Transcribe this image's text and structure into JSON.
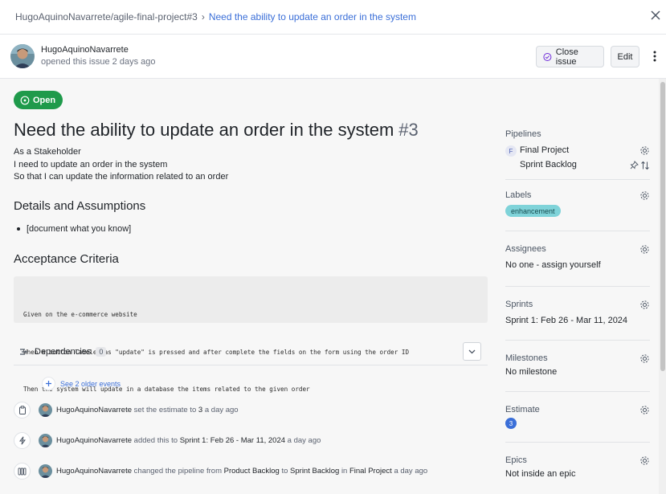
{
  "breadcrumb": {
    "repo": "HugoAquinoNavarrete/agile-final-project#3",
    "separator": "›",
    "current": "Need the ability to update an order in the system"
  },
  "header": {
    "author": "HugoAquinoNavarrete",
    "opened_text": "opened this issue 2 days ago",
    "close_button": "Close issue",
    "edit_button": "Edit"
  },
  "issue": {
    "status": "Open",
    "title": "Need the ability to update an order in the system",
    "number": "#3",
    "story": [
      "As a Stakeholder",
      "I need to update an order in the system",
      "So that I can update the information related to an order"
    ],
    "details_heading": "Details and Assumptions",
    "details_items": [
      "[document what you know]"
    ],
    "acceptance_heading": "Acceptance Criteria",
    "acceptance_code": [
      "Given on the e-commerce website",
      "When a button labeled as \"update\" is pressed and after complete the fields on the form using the order ID",
      "Then the system will update in a database the items related to the given order"
    ]
  },
  "dependencies": {
    "label": "Dependencies",
    "count": "0"
  },
  "timeline": {
    "older_link": "See 2 older events",
    "events": [
      {
        "icon": "clipboard-icon",
        "user": "HugoAquinoNavarrete",
        "text_a": "set the estimate to",
        "strong_a": "3",
        "time": "a day ago"
      },
      {
        "icon": "lightning-icon",
        "user": "HugoAquinoNavarrete",
        "text_a": "added this to",
        "strong_a": "Sprint 1: Feb 26 - Mar 11, 2024",
        "time": "a day ago"
      },
      {
        "icon": "pipeline-icon",
        "user": "HugoAquinoNavarrete",
        "text_a": "changed the pipeline from",
        "strong_a": "Product Backlog",
        "text_b": "to",
        "strong_b": "Sprint Backlog",
        "text_c": "in",
        "strong_c": "Final Project",
        "time": "a day ago"
      }
    ]
  },
  "sidebar": {
    "pipelines": {
      "label": "Pipelines",
      "workspace_badge": "F",
      "workspace": "Final Project",
      "pipeline": "Sprint Backlog"
    },
    "labels": {
      "label": "Labels",
      "chip": "enhancement",
      "chip_color": "#7fd3d9"
    },
    "assignees": {
      "label": "Assignees",
      "value": "No one -",
      "action": "assign yourself"
    },
    "sprints": {
      "label": "Sprints",
      "value": "Sprint 1: Feb 26 - Mar 11, 2024"
    },
    "milestones": {
      "label": "Milestones",
      "value": "No milestone"
    },
    "estimate": {
      "label": "Estimate",
      "value": "3"
    },
    "epics": {
      "label": "Epics",
      "value": "Not inside an epic"
    }
  },
  "colors": {
    "open_green": "#1f9a4b",
    "link_blue": "#3b6fd8"
  }
}
